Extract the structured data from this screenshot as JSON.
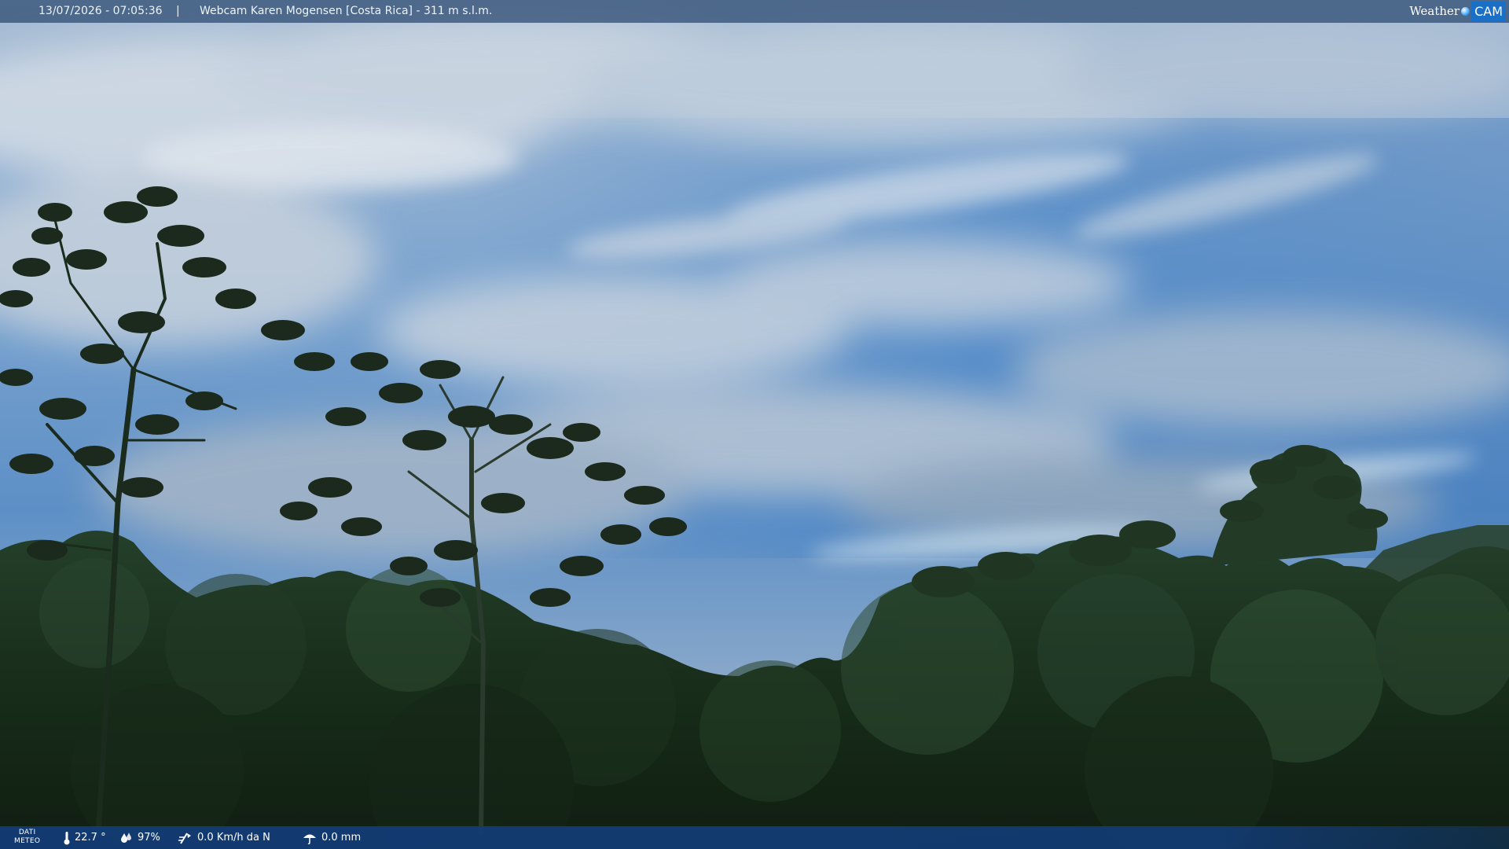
{
  "top_bar": {
    "datetime": "13/07/2026 - 07:05:36",
    "separator": "|",
    "title": "Webcam Karen Mogensen [Costa Rica] - 311 m s.l.m.",
    "brand_text": "Weather",
    "brand_cam": "CAM"
  },
  "bottom_bar": {
    "label_line1": "DATI",
    "label_line2": "METEO",
    "temperature": "22.7 °",
    "humidity": "97%",
    "wind": "0.0 Km/h da N",
    "rain": "0.0 mm"
  },
  "icons": {
    "temperature": "thermometer-icon",
    "humidity": "humidity-drop-icon",
    "wind": "wind-icon",
    "rain": "rain-umbrella-icon",
    "brand": "weathercam-logo"
  },
  "colors": {
    "sky_top": "#9fb8d3",
    "sky_blue": "#4e86c4",
    "cloud": "#c9d4e0",
    "foliage_dark": "#142415",
    "foliage_mid": "#25402a",
    "bar_top": "#284670",
    "bar_bottom": "#123c76"
  }
}
